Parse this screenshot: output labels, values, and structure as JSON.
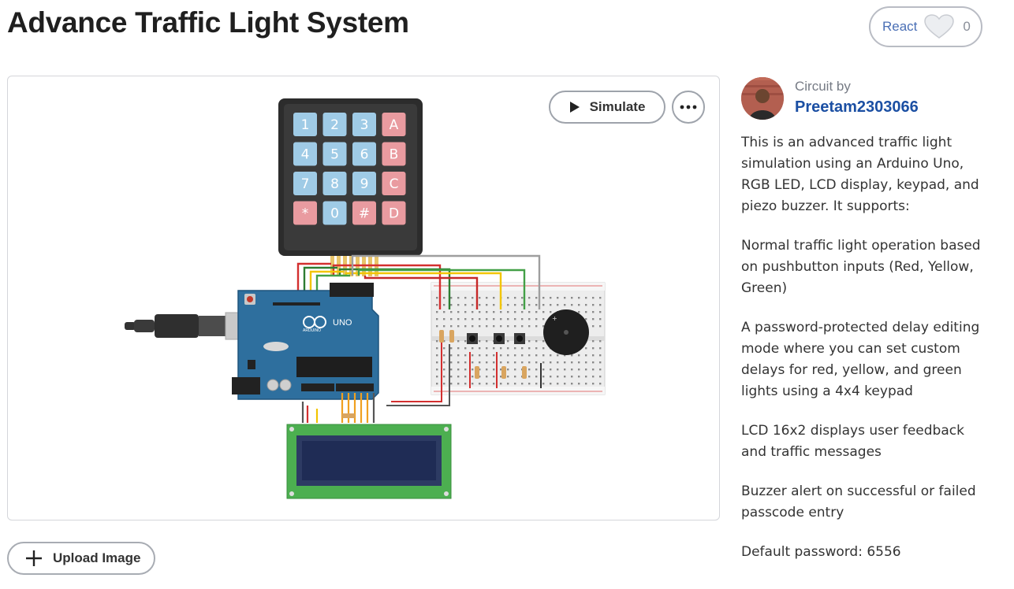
{
  "header": {
    "title": "Advance Traffic Light System",
    "react_label": "React",
    "react_count": "0"
  },
  "canvas": {
    "simulate_label": "Simulate",
    "keypad_keys": [
      "1",
      "2",
      "3",
      "A",
      "4",
      "5",
      "6",
      "B",
      "7",
      "8",
      "9",
      "C",
      "*",
      "0",
      "#",
      "D"
    ],
    "arduino_label": "UNO",
    "arduino_brand": "ARDUINO"
  },
  "upload": {
    "label": "Upload Image"
  },
  "author": {
    "circuit_by_label": "Circuit by",
    "name": "Preetam2303066"
  },
  "description": {
    "paragraphs": [
      "This is an advanced traffic light simulation using an Arduino Uno, RGB LED, LCD display, keypad, and piezo buzzer. It supports:",
      "Normal traffic light operation based on pushbutton inputs (Red, Yellow, Green)",
      "A password-protected delay editing mode where you can set custom delays for red, yellow, and green lights using a 4x4 keypad",
      "LCD 16x2 displays user feedback and traffic messages",
      "Buzzer alert on successful or failed passcode entry",
      "Default password: 6556"
    ]
  },
  "colors": {
    "accent_link": "#1b4fa3",
    "react_label": "#4a6fb5",
    "keypad_blue": "#9fcbe6",
    "keypad_red": "#e99ba0",
    "arduino_blue": "#2e6f9e",
    "lcd_green": "#4caf50",
    "lcd_screen": "#1f2c55"
  },
  "icons": {
    "heart": "heart-icon",
    "play": "play-icon",
    "more": "more-icon",
    "plus": "plus-icon"
  }
}
